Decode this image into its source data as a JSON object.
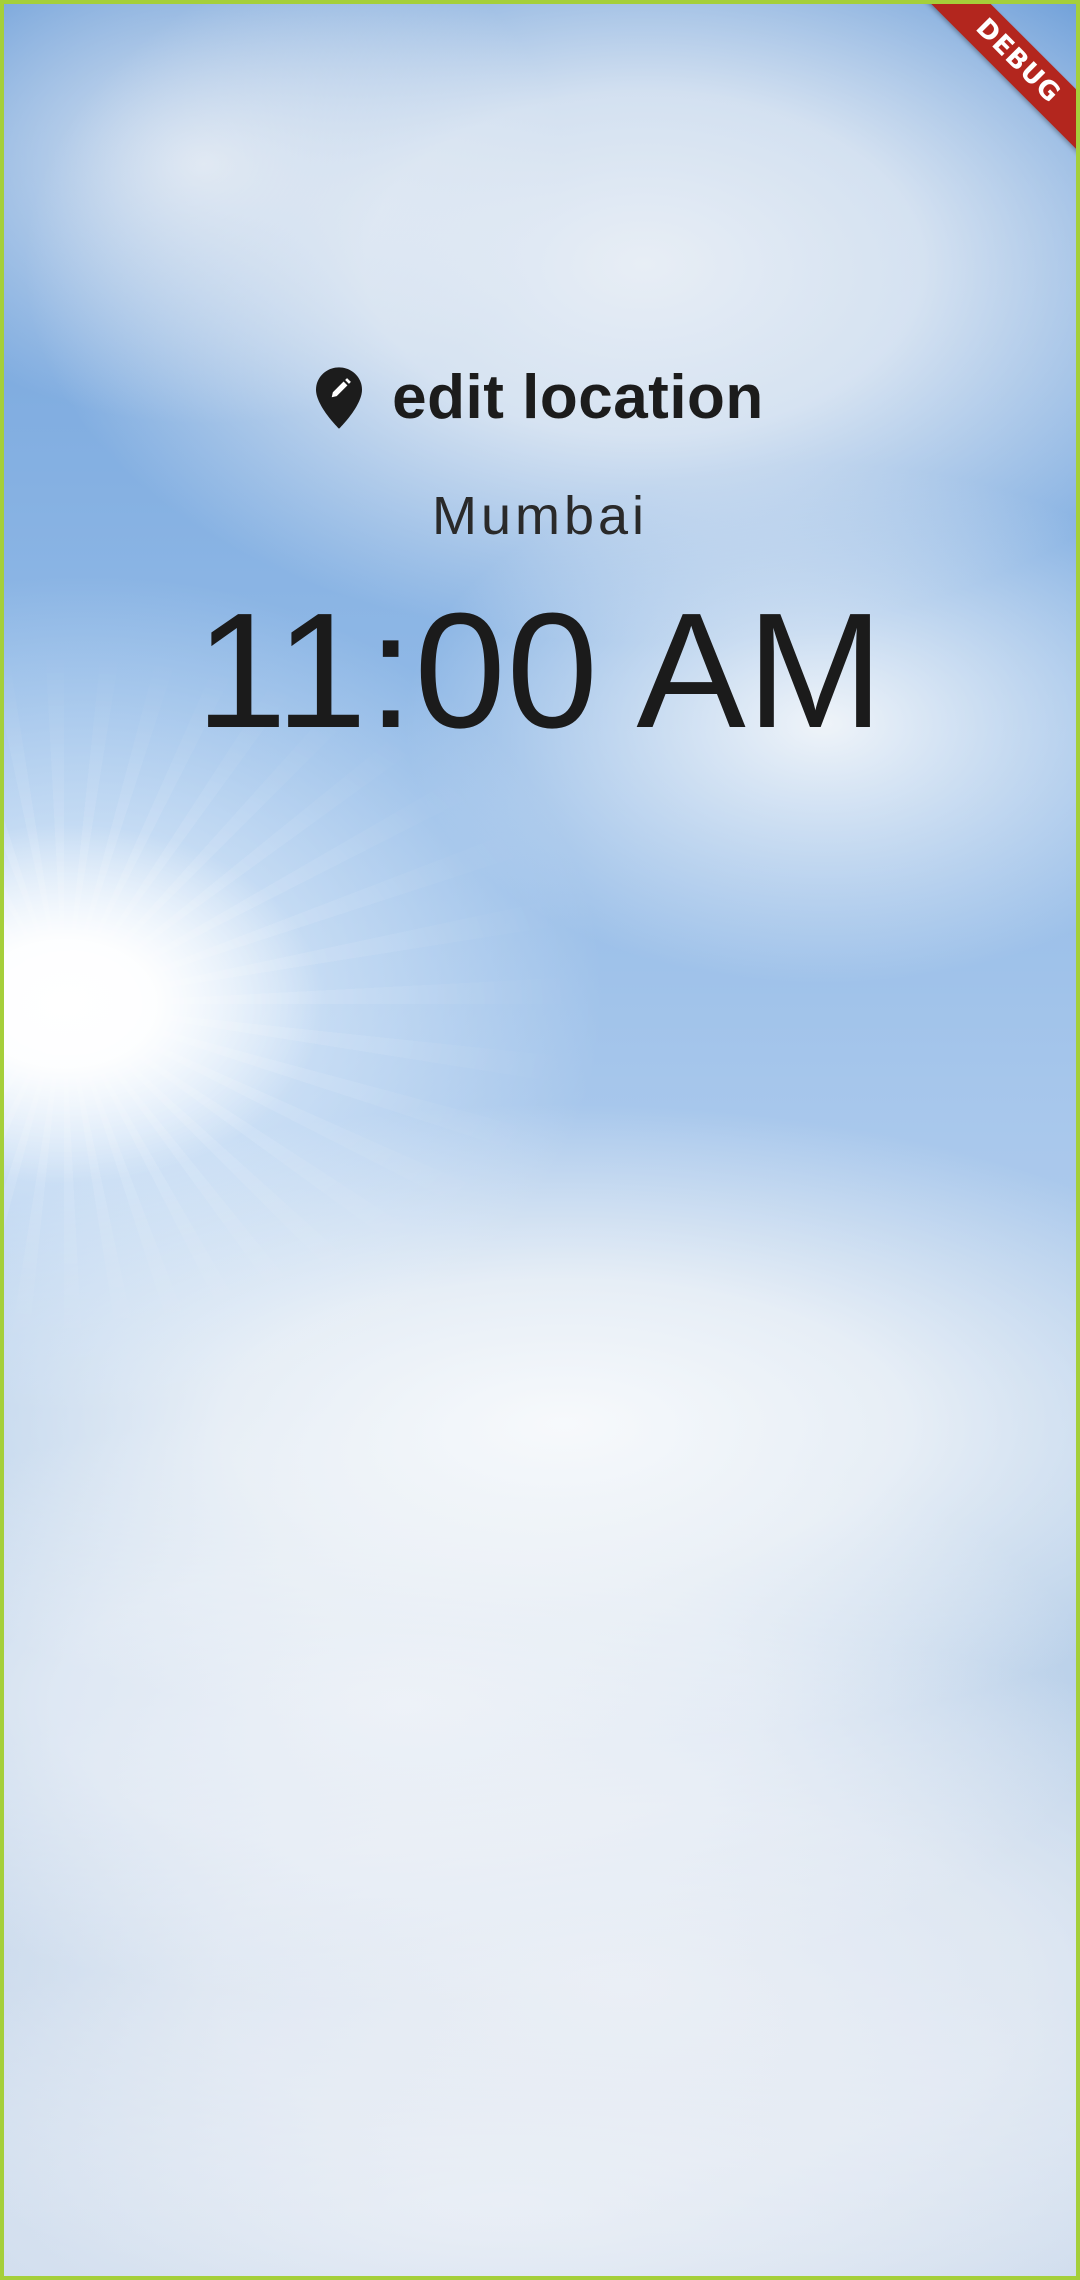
{
  "header": {
    "edit_location_label": "edit location",
    "edit_location_icon": "edit-location-icon"
  },
  "main": {
    "location": "Mumbai",
    "time": "11:00 AM"
  },
  "debug_banner": {
    "label": "DEBUG",
    "color": "#b3261e"
  },
  "theme": {
    "border_color": "#a5cf3a",
    "text_color": "#1c1c1c",
    "background": "daytime sky with clouds and sun"
  }
}
